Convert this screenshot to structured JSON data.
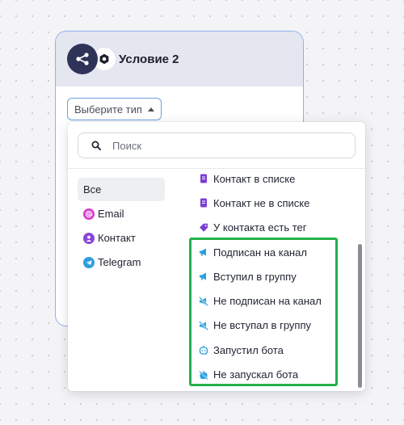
{
  "node": {
    "title": "Условие 2",
    "select_label": "Выберите тип"
  },
  "search": {
    "placeholder": "Поиск"
  },
  "categories": [
    {
      "label": "Все",
      "icon": "none",
      "active": true
    },
    {
      "label": "Email",
      "icon": "at-icon",
      "color": "#d63bd0"
    },
    {
      "label": "Контакт",
      "icon": "user-icon",
      "color": "#8a45d6"
    },
    {
      "label": "Telegram",
      "icon": "telegram-icon",
      "color": "#2b9fde"
    }
  ],
  "options": [
    {
      "label": "Контакт в списке",
      "icon": "list-doc-icon",
      "color": "#7a3fd1"
    },
    {
      "label": "Контакт не в списке",
      "icon": "list-doc-icon",
      "color": "#7a3fd1"
    },
    {
      "label": "У контакта есть тег",
      "icon": "tag-icon",
      "color": "#7a3fd1"
    },
    {
      "label": "Подписан на канал",
      "icon": "megaphone-icon",
      "color": "#2b9fde"
    },
    {
      "label": "Вступил в группу",
      "icon": "megaphone-icon",
      "color": "#2b9fde"
    },
    {
      "label": "Не подписан на канал",
      "icon": "megaphone-off-icon",
      "color": "#2b9fde"
    },
    {
      "label": "Не вступал в группу",
      "icon": "megaphone-off-icon",
      "color": "#2b9fde"
    },
    {
      "label": "Запустил бота",
      "icon": "bot-icon",
      "color": "#2b9fde"
    },
    {
      "label": "Не запускал бота",
      "icon": "bot-off-icon",
      "color": "#2b9fde"
    }
  ],
  "colors": {
    "highlight": "#24b04a",
    "node_border": "#8fb0ef",
    "node_icon_bg": "#2f3358"
  }
}
